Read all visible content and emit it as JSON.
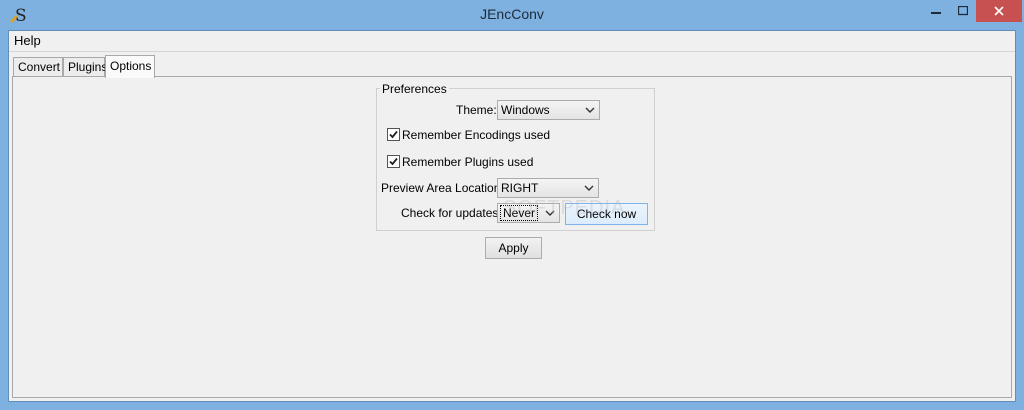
{
  "window": {
    "title": "JEncConv",
    "app_icon": "jencconv-s-icon"
  },
  "menu": {
    "help_label": "Help"
  },
  "tabs": [
    {
      "label": "Convert",
      "active": false
    },
    {
      "label": "Plugins",
      "active": false
    },
    {
      "label": "Options",
      "active": true
    }
  ],
  "preferences": {
    "group_title": "Preferences",
    "theme": {
      "label": "Theme:",
      "value": "Windows"
    },
    "remember_encodings": {
      "label": "Remember Encodings used",
      "checked": true
    },
    "remember_plugins": {
      "label": "Remember Plugins used",
      "checked": true
    },
    "preview_area": {
      "label": "Preview Area Location:",
      "value": "RIGHT"
    },
    "updates": {
      "label": "Check for updates:",
      "value": "Never",
      "button_label": "Check now"
    }
  },
  "apply_label": "Apply",
  "watermark": "SOFTPEDIA"
}
